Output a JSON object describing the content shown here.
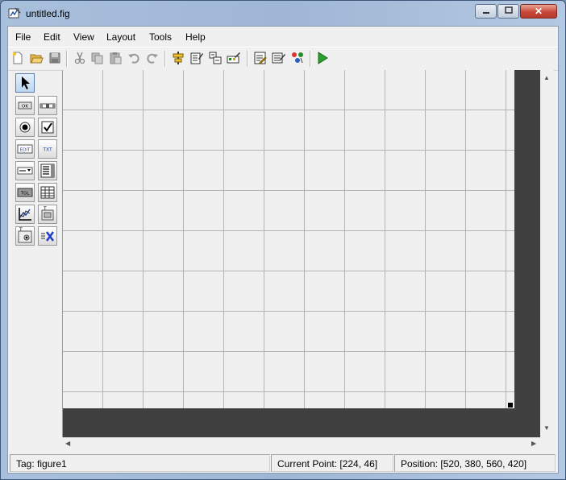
{
  "window": {
    "title": "untitled.fig",
    "icon": "guide-figure-icon",
    "controls": {
      "minimize_icon": "minimize-icon",
      "maximize_icon": "maximize-icon",
      "close_icon": "close-icon",
      "close_glyph": "✕"
    }
  },
  "menu": {
    "items": [
      "File",
      "Edit",
      "View",
      "Layout",
      "Tools",
      "Help"
    ]
  },
  "toolbar": {
    "items": [
      "new-figure-icon",
      "open-file-icon",
      "save-icon",
      "cut-icon",
      "copy-icon",
      "paste-icon",
      "undo-icon",
      "redo-icon",
      "align-objects-icon",
      "menu-editor-icon",
      "tab-order-editor-icon",
      "toolbar-editor-icon",
      "editor-icon",
      "property-inspector-icon",
      "object-browser-icon",
      "run-figure-icon"
    ]
  },
  "palette": {
    "items": [
      "select-arrow-icon",
      "push-button-icon",
      "slider-icon",
      "radio-button-icon",
      "check-box-icon",
      "edit-text-icon",
      "static-text-icon",
      "popup-menu-icon",
      "listbox-icon",
      "toggle-button-icon",
      "table-icon",
      "axes-icon",
      "panel-icon",
      "button-group-icon",
      "activex-control-icon"
    ],
    "labels": {
      "push": "OK",
      "edit": "EDIT",
      "text": "TXT",
      "toggle": "TGL"
    }
  },
  "status": {
    "tag": "Tag: figure1",
    "current_point": "Current Point:  [224, 46]",
    "position": "Position: [520, 380, 560, 420]"
  },
  "colors": {
    "canvas_bg": "#f0f0f0",
    "grid": "#b5b5b5",
    "figure_border": "#404040",
    "run_green": "#2aa02a"
  }
}
